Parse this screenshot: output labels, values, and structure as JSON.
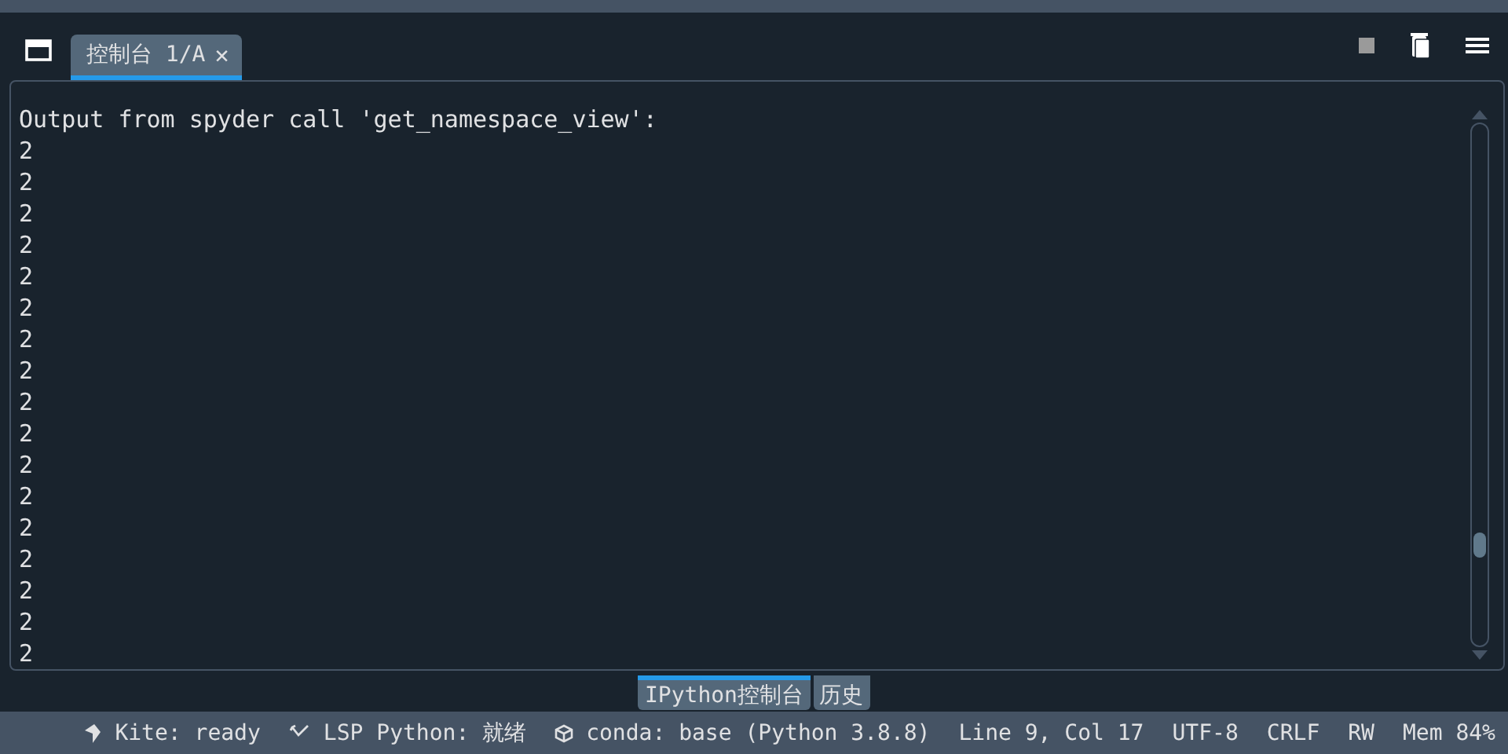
{
  "pane_tabs": [
    {
      "label": "控制台 1/A",
      "close": "✕",
      "selected": true
    }
  ],
  "console": {
    "lines": [
      "Output from spyder call 'get_namespace_view':",
      "2",
      "2",
      "2",
      "2",
      "2",
      "2",
      "2",
      "2",
      "2",
      "2",
      "2",
      "2",
      "2",
      "2",
      "2",
      "2",
      "2"
    ]
  },
  "bottom_tabs": [
    {
      "label": "IPython控制台",
      "selected": true
    },
    {
      "label": "历史",
      "selected": false
    }
  ],
  "status_bar": [
    {
      "kind": "kite",
      "text": "Kite: ready"
    },
    {
      "kind": "lsp",
      "text": "LSP Python: 就绪"
    },
    {
      "kind": "conda",
      "text": "conda: base (Python 3.8.8)"
    },
    {
      "kind": "text",
      "text": "Line 9, Col 17"
    },
    {
      "kind": "text",
      "text": "UTF-8"
    },
    {
      "kind": "text",
      "text": "CRLF"
    },
    {
      "kind": "text",
      "text": "RW"
    },
    {
      "kind": "text",
      "text": "Mem 84%"
    }
  ]
}
